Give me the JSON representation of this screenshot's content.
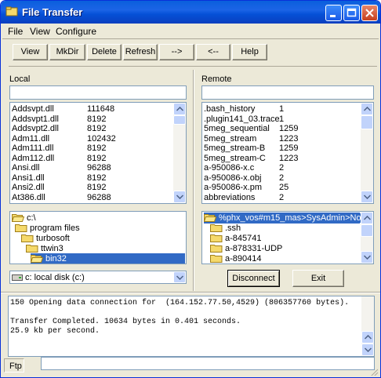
{
  "window": {
    "title": "File Transfer"
  },
  "menu": [
    "File",
    "View",
    "Configure"
  ],
  "toolbar": {
    "view": "View",
    "mkdir": "MkDir",
    "delete": "Delete",
    "refresh": "Refresh",
    "upload": "-->",
    "download": "<--",
    "help": "Help"
  },
  "local": {
    "label": "Local",
    "path_value": "",
    "files": [
      {
        "name": "Addsvpt.dll",
        "size": "111648"
      },
      {
        "name": "Addsvpt1.dll",
        "size": "8192"
      },
      {
        "name": "Addsvpt2.dll",
        "size": "8192"
      },
      {
        "name": "Adm11.dll",
        "size": "102432"
      },
      {
        "name": "Adm111.dll",
        "size": "8192"
      },
      {
        "name": "Adm112.dll",
        "size": "8192"
      },
      {
        "name": "Ansi.dll",
        "size": "96288"
      },
      {
        "name": "Ansi1.dll",
        "size": "8192"
      },
      {
        "name": "Ansi2.dll",
        "size": "8192"
      },
      {
        "name": "At386.dll",
        "size": "96288"
      }
    ],
    "tree": [
      "c:\\",
      "program files",
      "turbosoft",
      "ttwin3",
      "bin32"
    ],
    "drive": "c: local disk (c:)"
  },
  "remote": {
    "label": "Remote",
    "path_value": "",
    "files": [
      {
        "name": ".bash_history",
        "size": "1"
      },
      {
        "name": ".plugin141_03.trace",
        "size": "1"
      },
      {
        "name": "5meg_sequential",
        "size": "1259"
      },
      {
        "name": "5meg_stream",
        "size": "1223"
      },
      {
        "name": "5meg_stream-B",
        "size": "1259"
      },
      {
        "name": "5meg_stream-C",
        "size": "1223"
      },
      {
        "name": "a-950086-x.c",
        "size": "2"
      },
      {
        "name": "a-950086-x.obj",
        "size": "2"
      },
      {
        "name": "a-950086-x.pm",
        "size": "25"
      },
      {
        "name": "abbreviations",
        "size": "2"
      }
    ],
    "tree": [
      "%phx_vos#m15_mas>SysAdmin>No",
      ".ssh",
      "a-845741",
      "a-878331-UDP",
      "a-890414"
    ],
    "disconnect": "Disconnect",
    "exit": "Exit"
  },
  "log": [
    "150 Opening data connection for  (164.152.77.50,4529) (806357760 bytes).",
    "",
    "Transfer Completed. 10634 bytes in 0.401 seconds.",
    "25.9 kb per second."
  ],
  "status": {
    "label": "Ftp",
    "value": ""
  },
  "colors": {
    "titlebar": "#0a5fdc",
    "selection": "#316ac5",
    "face": "#ece9d8"
  }
}
